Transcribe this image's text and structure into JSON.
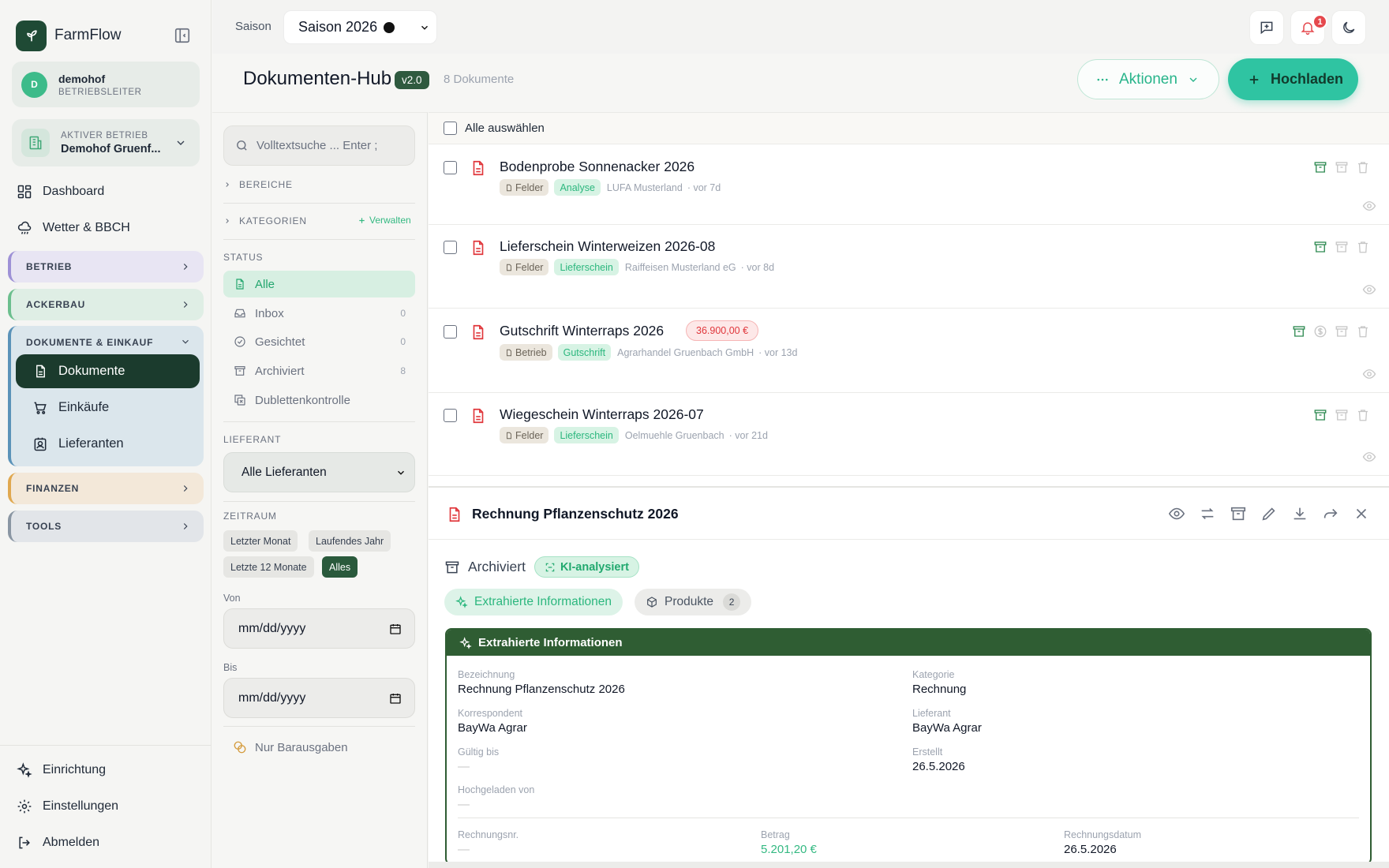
{
  "app": {
    "name": "FarmFlow"
  },
  "user": {
    "initial": "D",
    "name": "demohof",
    "role": "BETRIEBSLEITER"
  },
  "farm": {
    "label": "AKTIVER BETRIEB",
    "name": "Demohof Gruenf..."
  },
  "nav": {
    "dashboard": "Dashboard",
    "weather": "Wetter & BBCH",
    "groups": {
      "betrieb": "BETRIEB",
      "ackerbau": "ACKERBAU",
      "dokumente": "DOKUMENTE & EINKAUF",
      "finanzen": "FINANZEN",
      "tools": "TOOLS"
    },
    "sub": {
      "dokumente": "Dokumente",
      "einkaeufe": "Einkäufe",
      "lieferanten": "Lieferanten"
    },
    "bottom": {
      "setup": "Einrichtung",
      "settings": "Einstellungen",
      "logout": "Abmelden"
    }
  },
  "topbar": {
    "season_label": "Saison",
    "season_value": "Saison 2026",
    "notifications": "1"
  },
  "header": {
    "title": "Dokumenten-Hub",
    "version": "v2.0",
    "count": "8 Dokumente",
    "actions": "Aktionen",
    "upload": "Hochladen"
  },
  "filters": {
    "search_placeholder": "Volltextsuche ... Enter ;",
    "areas": "BEREICHE",
    "categories": "KATEGORIEN",
    "manage": "Verwalten",
    "status_title": "STATUS",
    "status": [
      {
        "label": "Alle",
        "count": ""
      },
      {
        "label": "Inbox",
        "count": "0"
      },
      {
        "label": "Gesichtet",
        "count": "0"
      },
      {
        "label": "Archiviert",
        "count": "8"
      },
      {
        "label": "Dublettenkontrolle",
        "count": ""
      }
    ],
    "supplier_title": "LIEFERANT",
    "supplier_value": "Alle Lieferanten",
    "period_title": "ZEITRAUM",
    "periods": [
      "Letzter Monat",
      "Laufendes Jahr",
      "Letzte 12 Monate",
      "Alles"
    ],
    "from_label": "Von",
    "to_label": "Bis",
    "date_placeholder": "mm/dd/yyyy",
    "cash_only": "Nur Barausgaben"
  },
  "list": {
    "select_all": "Alle auswählen",
    "rows": [
      {
        "title": "Bodenprobe Sonnenacker 2026",
        "area": "Felder",
        "type": "Analyse",
        "supplier": "LUFA Musterland",
        "age": "· vor 7d",
        "amount": ""
      },
      {
        "title": "Lieferschein Winterweizen 2026-08",
        "area": "Felder",
        "type": "Lieferschein",
        "supplier": "Raiffeisen Musterland eG",
        "age": "· vor 8d",
        "amount": ""
      },
      {
        "title": "Gutschrift Winterraps 2026",
        "area": "Betrieb",
        "type": "Gutschrift",
        "supplier": "Agrarhandel Gruenbach GmbH",
        "age": "· vor 13d",
        "amount": "36.900,00 €"
      },
      {
        "title": "Wiegeschein Winterraps 2026-07",
        "area": "Felder",
        "type": "Lieferschein",
        "supplier": "Oelmuehle Gruenbach",
        "age": "· vor 21d",
        "amount": ""
      }
    ]
  },
  "detail": {
    "title": "Rechnung Pflanzenschutz 2026",
    "status": "Archiviert",
    "ai_badge": "KI-analysiert",
    "tab_extract": "Extrahierte Informationen",
    "tab_products": "Produkte",
    "products_count": "2",
    "card_title": "Extrahierte Informationen",
    "fields": {
      "bezeichnung_label": "Bezeichnung",
      "bezeichnung": "Rechnung Pflanzenschutz 2026",
      "kategorie_label": "Kategorie",
      "kategorie": "Rechnung",
      "korrespondent_label": "Korrespondent",
      "korrespondent": "BayWa Agrar",
      "lieferant_label": "Lieferant",
      "lieferant": "BayWa Agrar",
      "gueltig_label": "Gültig bis",
      "gueltig": "—",
      "erstellt_label": "Erstellt",
      "erstellt": "26.5.2026",
      "hochgeladen_label": "Hochgeladen von",
      "hochgeladen": "—",
      "rechnungsnr_label": "Rechnungsnr.",
      "rechnungsnr": "—",
      "betrag_label": "Betrag",
      "betrag": "5.201,20 €",
      "rechnungsdatum_label": "Rechnungsdatum",
      "rechnungsdatum": "26.5.2026"
    }
  },
  "colors": {
    "brand": "#1f4a35",
    "accent": "#2fc4a2",
    "green_text": "#2cb77e",
    "danger": "#e0363b",
    "card_header": "#2f5d33"
  }
}
